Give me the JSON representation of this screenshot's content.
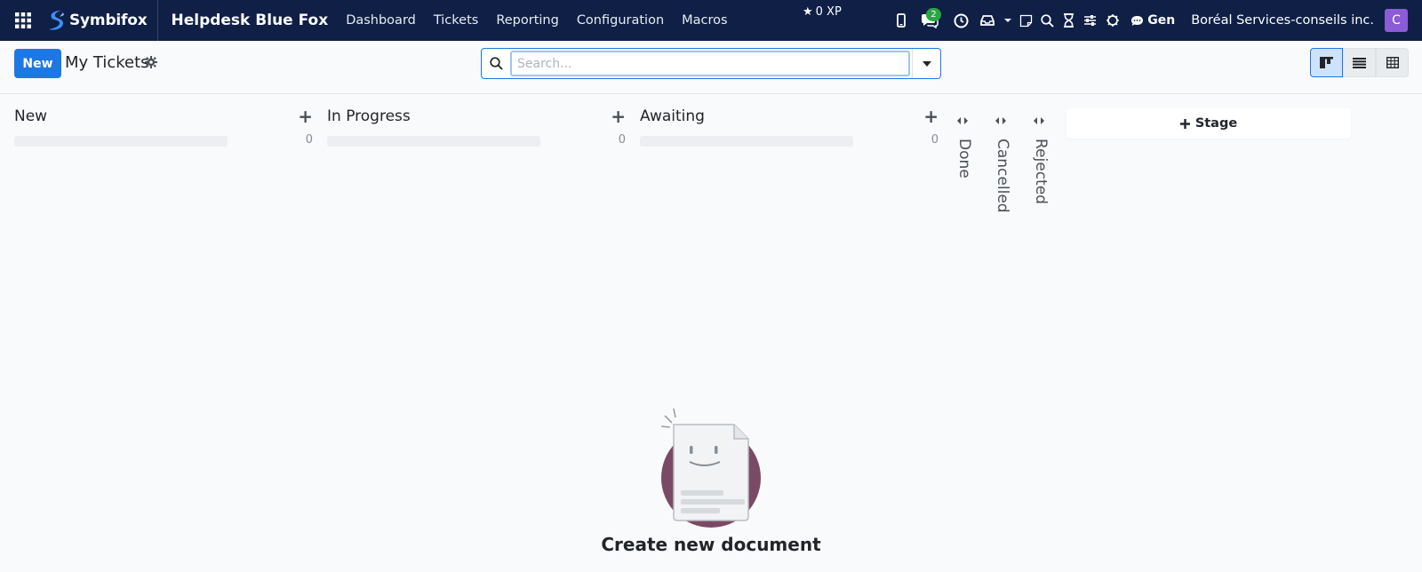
{
  "navbar": {
    "brand": "Symbifox",
    "app_name": "Helpdesk Blue Fox",
    "menu": [
      "Dashboard",
      "Tickets",
      "Reporting",
      "Configuration",
      "Macros"
    ],
    "xp": "0 XP",
    "messages_badge": "2",
    "user_short": "Gen",
    "company": "Boréal Services-conseils inc.",
    "avatar_letter": "C",
    "bg_color": "#0f1f46"
  },
  "control_panel": {
    "new_label": "New",
    "breadcrumb": "My Tickets",
    "search_placeholder": "Search...",
    "views": [
      "kanban",
      "list",
      "pivot"
    ],
    "active_view": "kanban",
    "accent_color": "#1e78e3"
  },
  "kanban": {
    "columns": [
      {
        "title": "New",
        "count": "0"
      },
      {
        "title": "In Progress",
        "count": "0"
      },
      {
        "title": "Awaiting",
        "count": "0"
      }
    ],
    "folded_columns": [
      "Done",
      "Cancelled",
      "Rejected"
    ],
    "add_stage_label": "Stage"
  },
  "empty_state": {
    "title": "Create new document"
  }
}
